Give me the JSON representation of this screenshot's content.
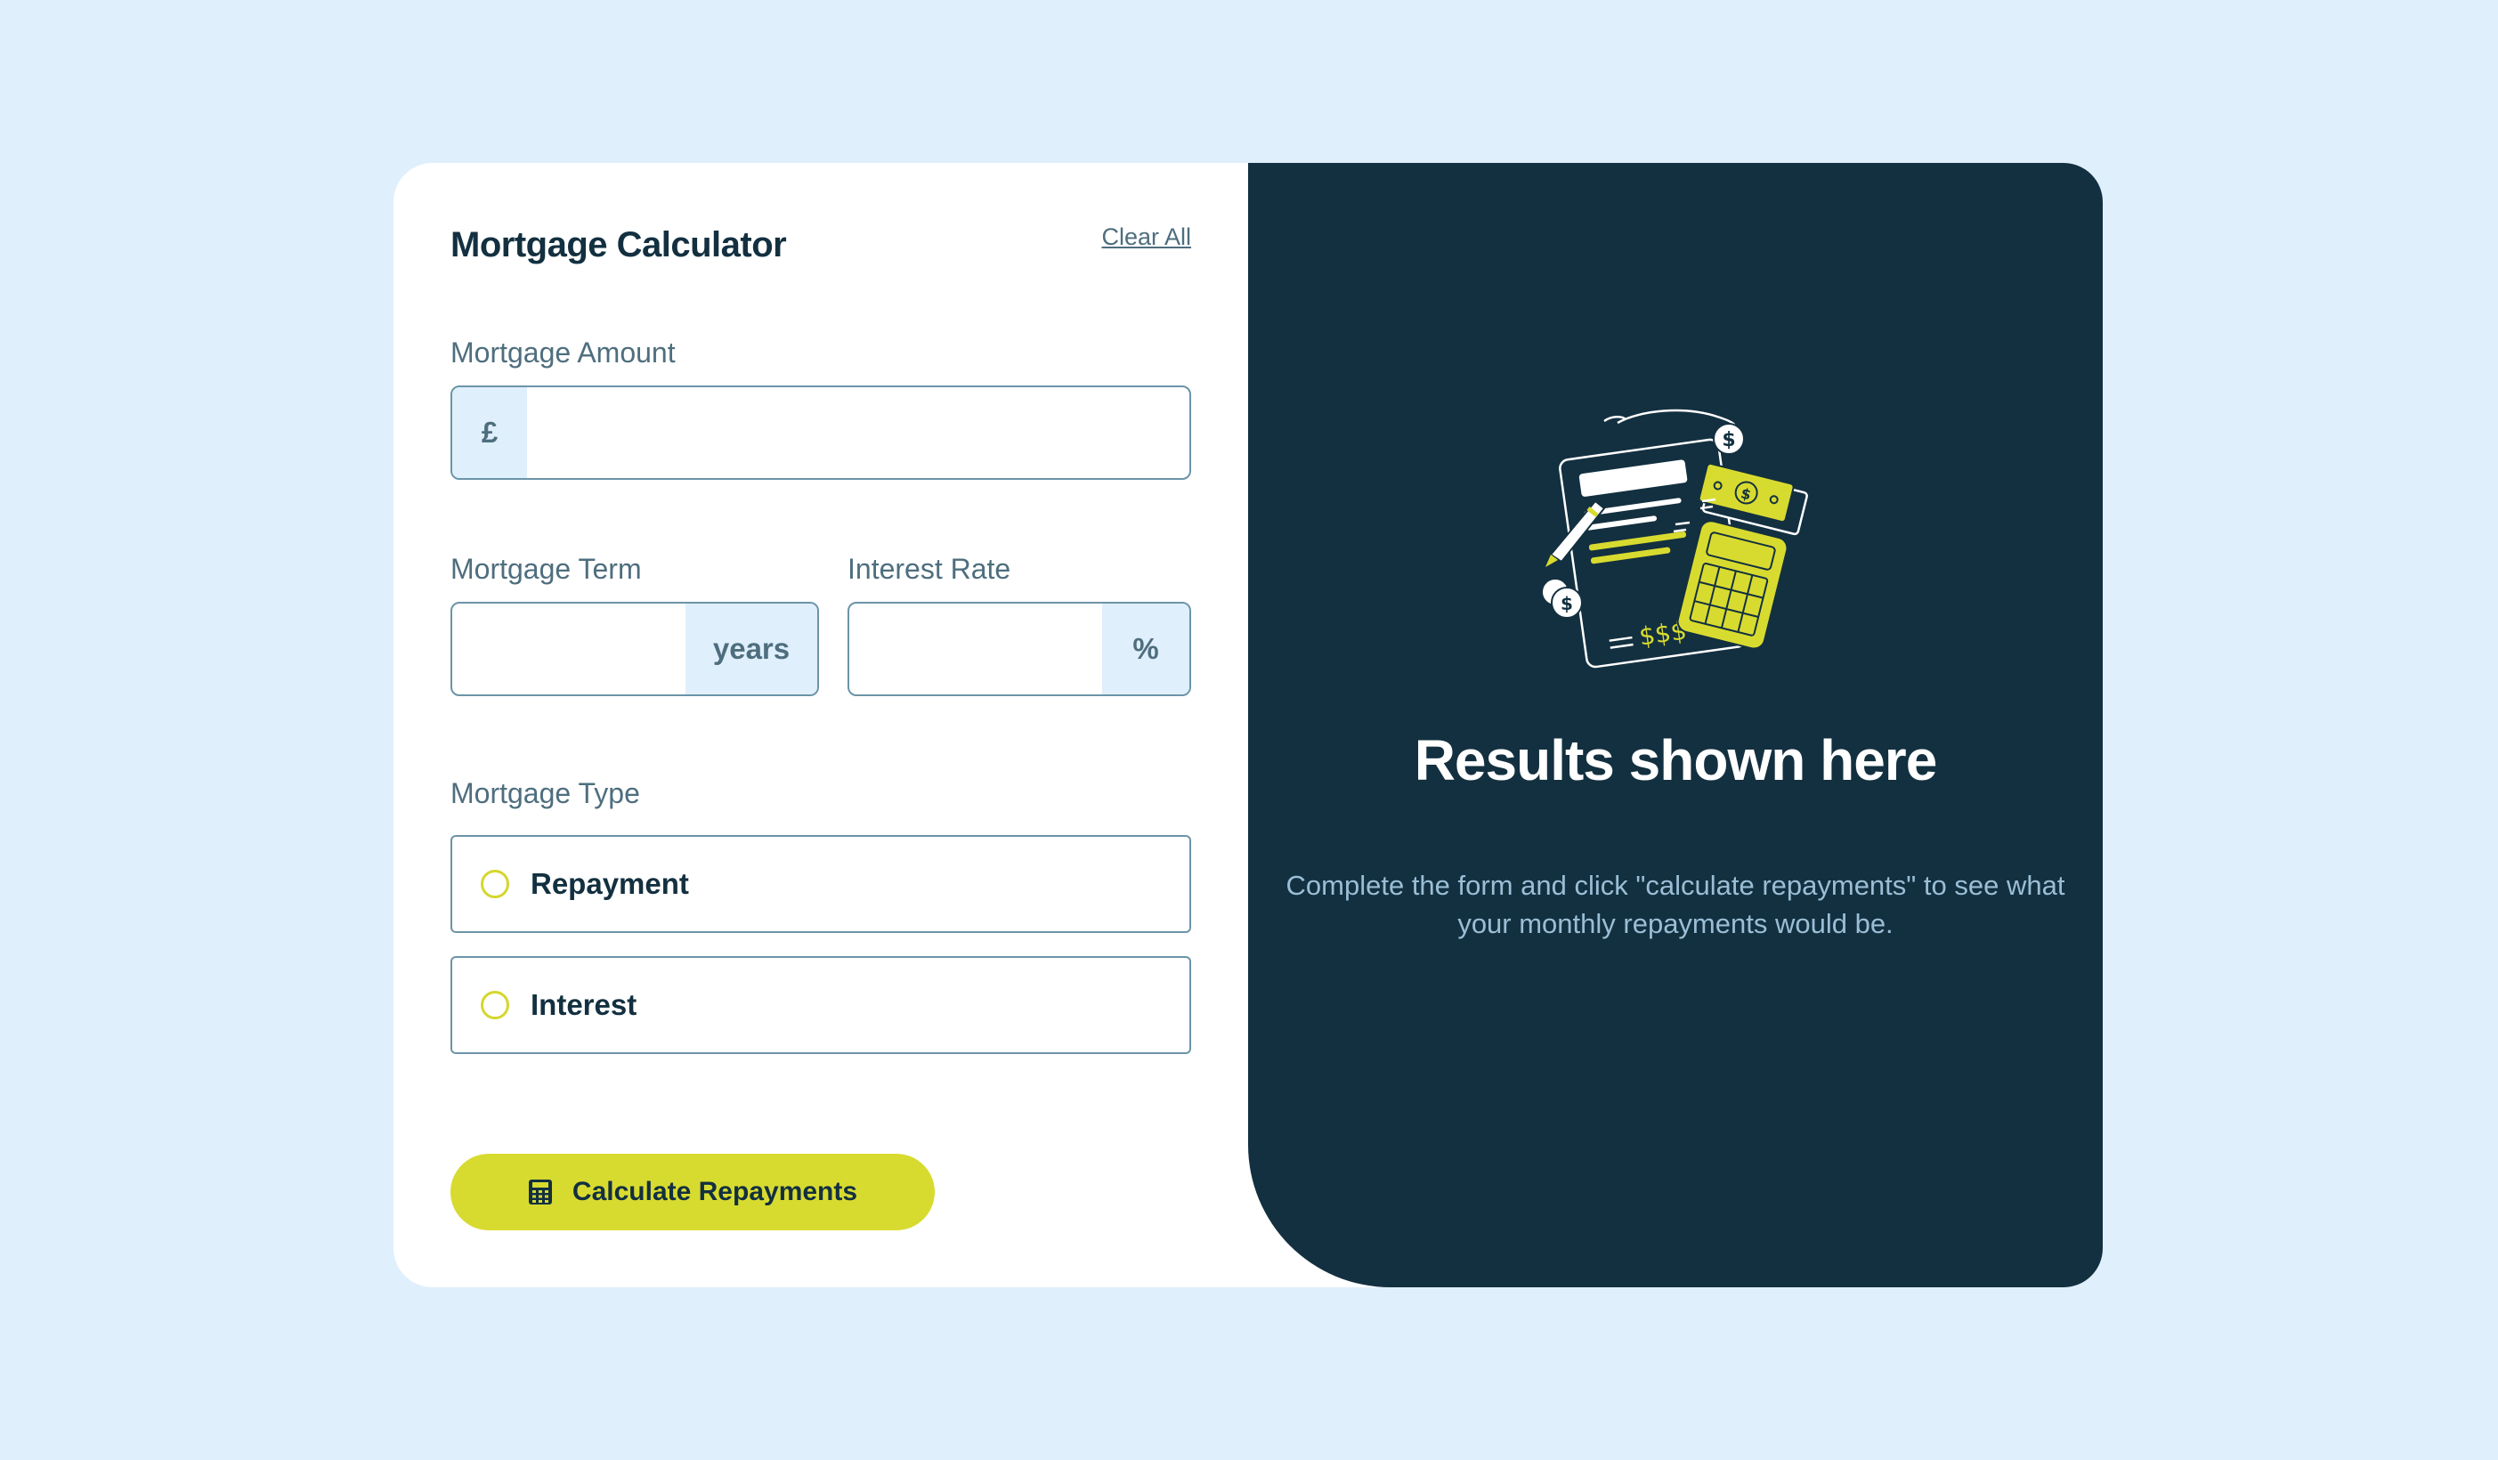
{
  "form": {
    "title": "Mortgage Calculator",
    "clear_all": "Clear All",
    "amount": {
      "label": "Mortgage Amount",
      "prefix": "£",
      "value": ""
    },
    "term": {
      "label": "Mortgage Term",
      "suffix": "years",
      "value": ""
    },
    "rate": {
      "label": "Interest Rate",
      "suffix": "%",
      "value": ""
    },
    "type": {
      "label": "Mortgage Type",
      "options": [
        "Repayment",
        "Interest"
      ],
      "selected": null
    },
    "submit_label": "Calculate Repayments"
  },
  "results": {
    "heading": "Results shown here",
    "message": "Complete the form and click \"calculate repayments\" to see what your monthly repayments would be."
  },
  "icons": {
    "calculate_button": "calculator-icon",
    "illustration": "finance-illustration"
  },
  "colors": {
    "page_bg": "#e0effc",
    "card_bg": "#ffffff",
    "results_bg": "#133040",
    "accent_lime": "#d8db2f",
    "field_border": "#6b94a8",
    "muted_text": "#4e6e7e",
    "dark_text": "#133040",
    "results_text": "#9abed5"
  }
}
